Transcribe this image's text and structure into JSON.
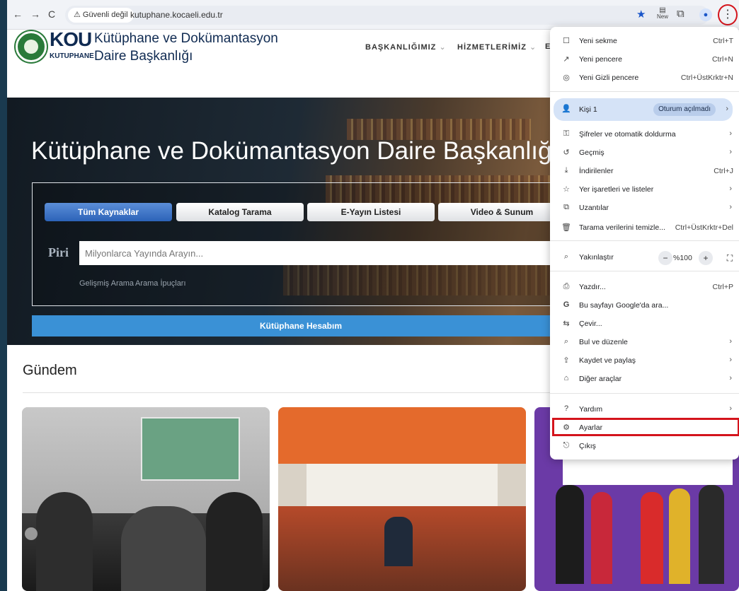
{
  "browser": {
    "security_label": "Güvenli değil",
    "url": "kutuphane.kocaeli.edu.tr",
    "new_badge": "New"
  },
  "site": {
    "logo_text": "KOU",
    "logo_sub": "KUTUPHANE",
    "title_line1": "Kütüphane ve Dokümantasyon",
    "title_line2": "Daire Başkanlığı",
    "nav": [
      {
        "label": "BAŞKANLIĞIMIZ"
      },
      {
        "label": "HİZMETLERİMİZ"
      },
      {
        "label": "E"
      }
    ]
  },
  "hero": {
    "title": "Kütüphane ve Dokümantasyon Daire Başkanlığı",
    "tabs": [
      {
        "label": "Tüm Kaynaklar"
      },
      {
        "label": "Katalog Tarama"
      },
      {
        "label": "E-Yayın Listesi"
      },
      {
        "label": "Video & Sunum"
      }
    ],
    "piri_logo": "Piri",
    "search_placeholder": "Milyonlarca Yayında Arayın...",
    "advanced_search": "Gelişmiş Arama",
    "search_tips": "Arama İpuçları",
    "account_button": "Kütüphane Hesabım"
  },
  "news": {
    "heading": "Gündem"
  },
  "menu": {
    "items": [
      {
        "icon": "☐",
        "label": "Yeni sekme",
        "shortcut": "Ctrl+T"
      },
      {
        "icon": "↗",
        "label": "Yeni pencere",
        "shortcut": "Ctrl+N"
      },
      {
        "icon": "◎",
        "label": "Yeni Gizli pencere",
        "shortcut": "Ctrl+ÜstKrktr+N"
      }
    ],
    "profile": {
      "label": "Kişi 1",
      "status": "Oturum açılmadı"
    },
    "group2": [
      {
        "icon": "⚿",
        "label": "Şifreler ve otomatik doldurma",
        "arrow": "›"
      },
      {
        "icon": "↺",
        "label": "Geçmiş",
        "arrow": "›"
      },
      {
        "icon": "⤓",
        "label": "İndirilenler",
        "shortcut": "Ctrl+J"
      },
      {
        "icon": "☆",
        "label": "Yer işaretleri ve listeler",
        "arrow": "›"
      },
      {
        "icon": "⧉",
        "label": "Uzantılar",
        "arrow": "›"
      },
      {
        "icon": "🗑",
        "label": "Tarama verilerini temizle...",
        "shortcut": "Ctrl+ÜstKrktr+Del"
      }
    ],
    "zoom": {
      "label": "Yakınlaştır",
      "minus": "−",
      "value": "%100",
      "plus": "+",
      "fullscreen": "⛶"
    },
    "group3": [
      {
        "icon": "⎙",
        "label": "Yazdır...",
        "shortcut": "Ctrl+P"
      },
      {
        "icon": "G",
        "label": "Bu sayfayı Google'da ara..."
      },
      {
        "icon": "⇆",
        "label": "Çevir..."
      },
      {
        "icon": "⌕",
        "label": "Bul ve düzenle",
        "arrow": "›"
      },
      {
        "icon": "⇪",
        "label": "Kaydet ve paylaş",
        "arrow": "›"
      },
      {
        "icon": "⌂",
        "label": "Diğer araçlar",
        "arrow": "›"
      }
    ],
    "group4": [
      {
        "icon": "?",
        "label": "Yardım",
        "arrow": "›"
      },
      {
        "icon": "⚙",
        "label": "Ayarlar"
      },
      {
        "icon": "⎋",
        "label": "Çıkış"
      }
    ]
  },
  "colors": {
    "highlight_red": "#d4141c",
    "accent_blue": "#1a56c9",
    "account_btn": "#3a91d6"
  }
}
